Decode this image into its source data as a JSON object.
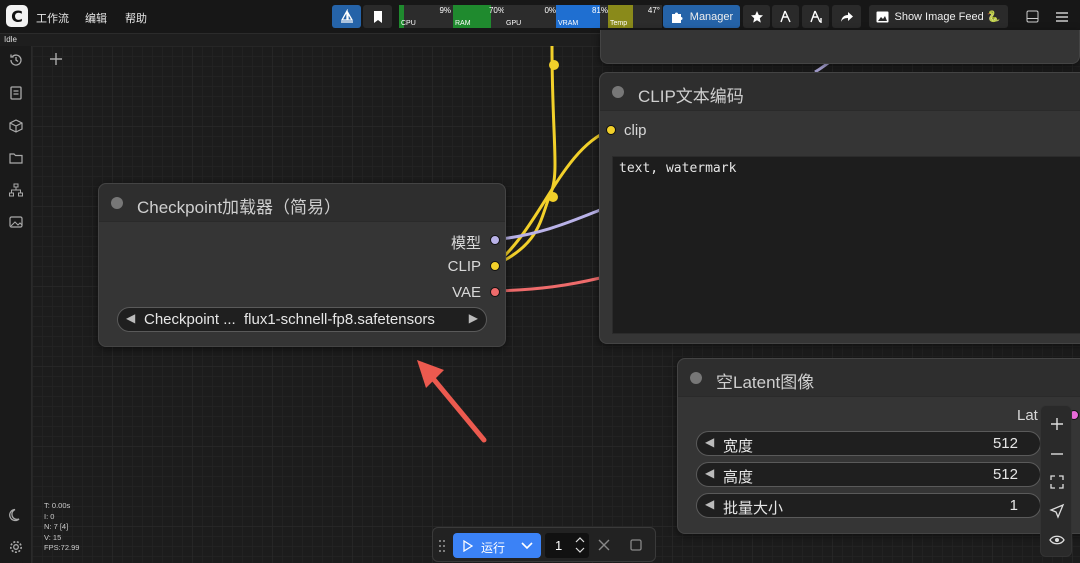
{
  "menu": {
    "workflow": "工作流",
    "edit": "编辑",
    "help": "帮助"
  },
  "status": "Idle",
  "monitors": [
    {
      "label": "CPU",
      "value": "9%",
      "percent": 9,
      "color": "#1f8a2e"
    },
    {
      "label": "RAM",
      "value": "70%",
      "percent": 70,
      "color": "#1f8a2e"
    },
    {
      "label": "GPU",
      "value": "0%",
      "percent": 0,
      "color": "#1f8a2e"
    },
    {
      "label": "VRAM",
      "value": "81%",
      "percent": 81,
      "color": "#1f6fd1"
    },
    {
      "label": "Temp",
      "value": "47°",
      "percent": 47,
      "color": "#8a8a1a"
    }
  ],
  "toolbar": {
    "manager_label": "Manager",
    "image_feed_label": "Show Image Feed 🐍",
    "accent": "#2563a8"
  },
  "nodes": {
    "checkpoint": {
      "title": "Checkpoint加载器（简易）",
      "outputs": [
        {
          "label": "模型",
          "color": "#b9b2e8"
        },
        {
          "label": "CLIP",
          "color": "#f2d02a"
        },
        {
          "label": "VAE",
          "color": "#ee6b6b"
        }
      ],
      "widget": {
        "label": "Checkpoint ...",
        "value": "flux1-schnell-fp8.safetensors"
      }
    },
    "clip": {
      "title": "CLIP文本编码",
      "input": {
        "label": "clip",
        "color": "#f2d02a"
      },
      "text": "text, watermark"
    },
    "latent": {
      "title": "空Latent图像",
      "output_label": "Lat",
      "output_color": "#e86ad8",
      "widgets": [
        {
          "label": "宽度",
          "value": "512"
        },
        {
          "label": "高度",
          "value": "512"
        },
        {
          "label": "批量大小",
          "value": "1"
        }
      ]
    }
  },
  "runbar": {
    "run_label": "运行",
    "batch_count": "1"
  },
  "stats": [
    "T: 0.00s",
    "I: 0",
    "N: 7 [4]",
    "V: 15",
    "FPS:72.99"
  ]
}
